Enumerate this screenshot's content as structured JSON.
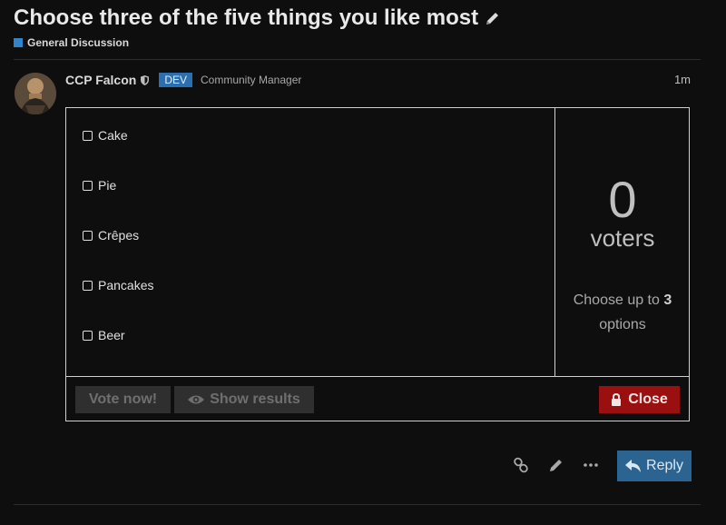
{
  "topic": {
    "title": "Choose three of the five things you like most",
    "category": "General Discussion",
    "category_color": "#2e86c9"
  },
  "post": {
    "author": "CCP Falcon",
    "badge": "DEV",
    "role": "Community Manager",
    "age": "1m"
  },
  "poll": {
    "options": [
      "Cake",
      "Pie",
      "Crêpes",
      "Pancakes",
      "Beer"
    ],
    "voters_count": "0",
    "voters_label": "voters",
    "hint_prefix": "Choose up to",
    "hint_max": "3",
    "hint_suffix": "options",
    "vote_label": "Vote now!",
    "show_results_label": "Show results",
    "close_label": "Close",
    "close_color": "#9a0f0f"
  },
  "post_actions": {
    "icons": [
      "link-icon",
      "edit-icon",
      "more-icon"
    ],
    "reply_label": "Reply"
  }
}
